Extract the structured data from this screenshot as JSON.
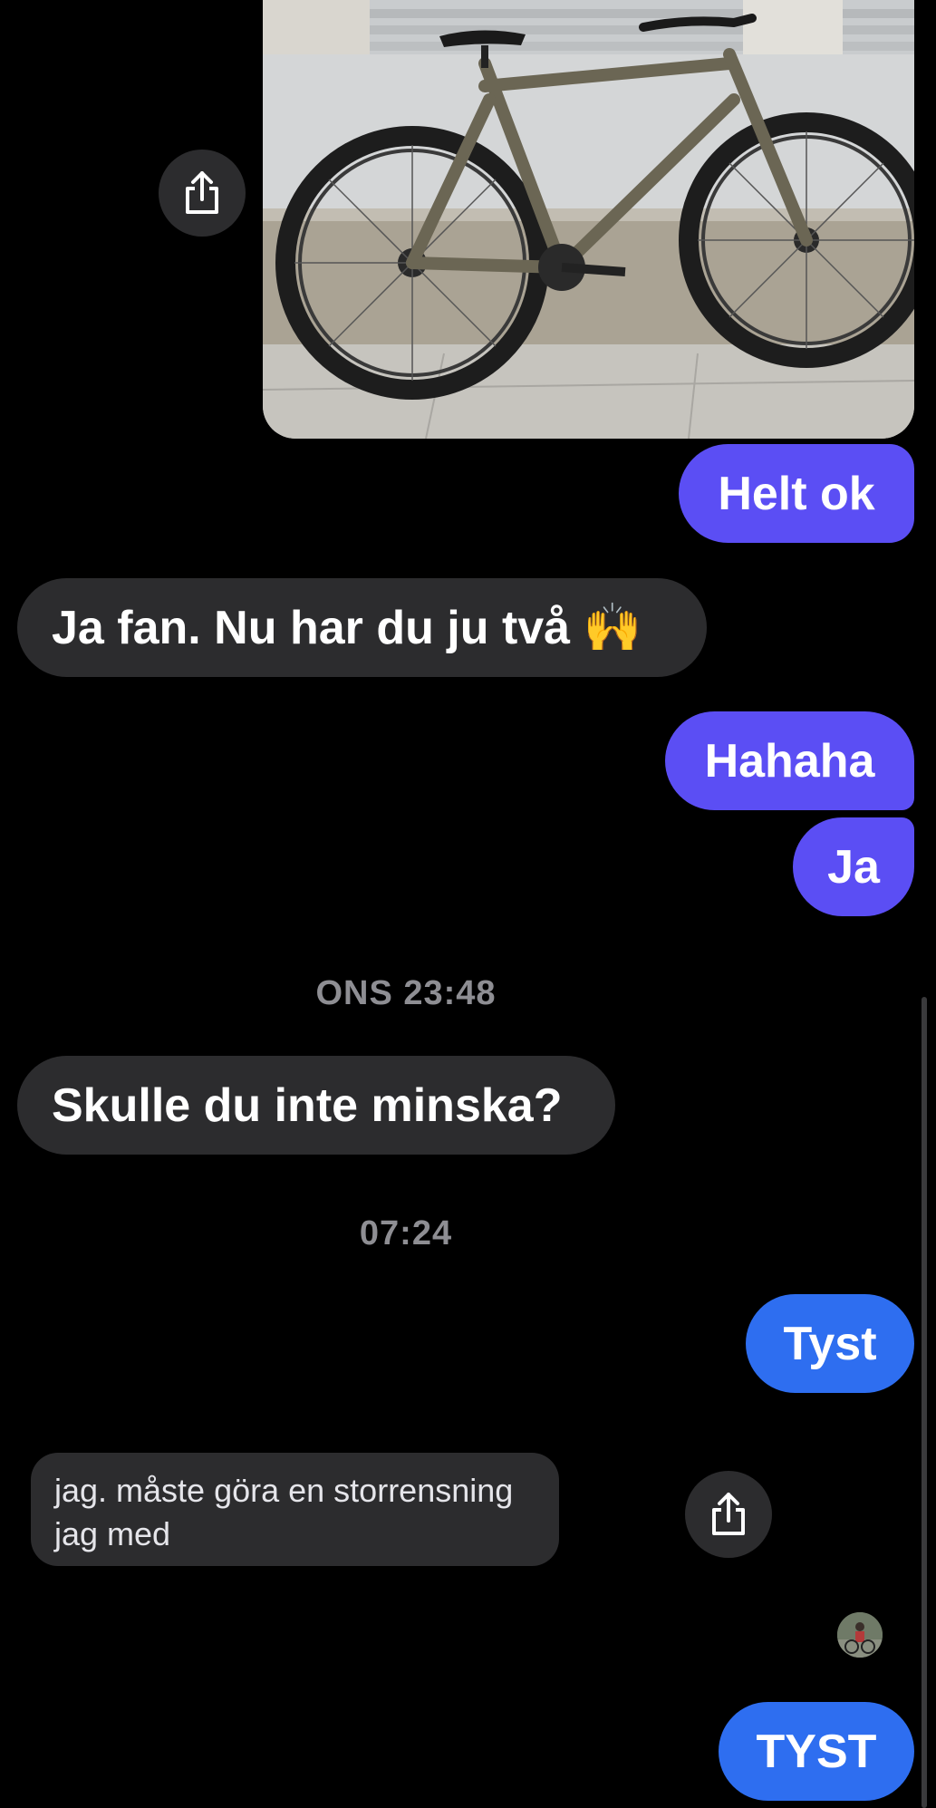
{
  "colors": {
    "background": "#000000",
    "bubble_outgoing_purple": "#5b4ef4",
    "bubble_outgoing_blue": "#2e6ef0",
    "bubble_incoming": "#2c2c2e",
    "timestamp": "#8e8e93"
  },
  "messages": {
    "m1": {
      "text": "Helt ok"
    },
    "m2": {
      "text": "Ja fan. Nu har du ju två 🙌"
    },
    "m3": {
      "text": "Hahaha"
    },
    "m4": {
      "text": "Ja"
    },
    "m5": {
      "text": "Skulle du inte minska?"
    },
    "m6": {
      "text": "Tyst"
    },
    "m7": {
      "line1": "jag. måste göra en storrensning",
      "line2": "jag med"
    },
    "m8": {
      "text": "TYST"
    }
  },
  "timestamps": {
    "t1": "ONS 23:48",
    "t2": "07:24"
  },
  "icons": {
    "share": "share-icon",
    "avatar": "avatar"
  }
}
